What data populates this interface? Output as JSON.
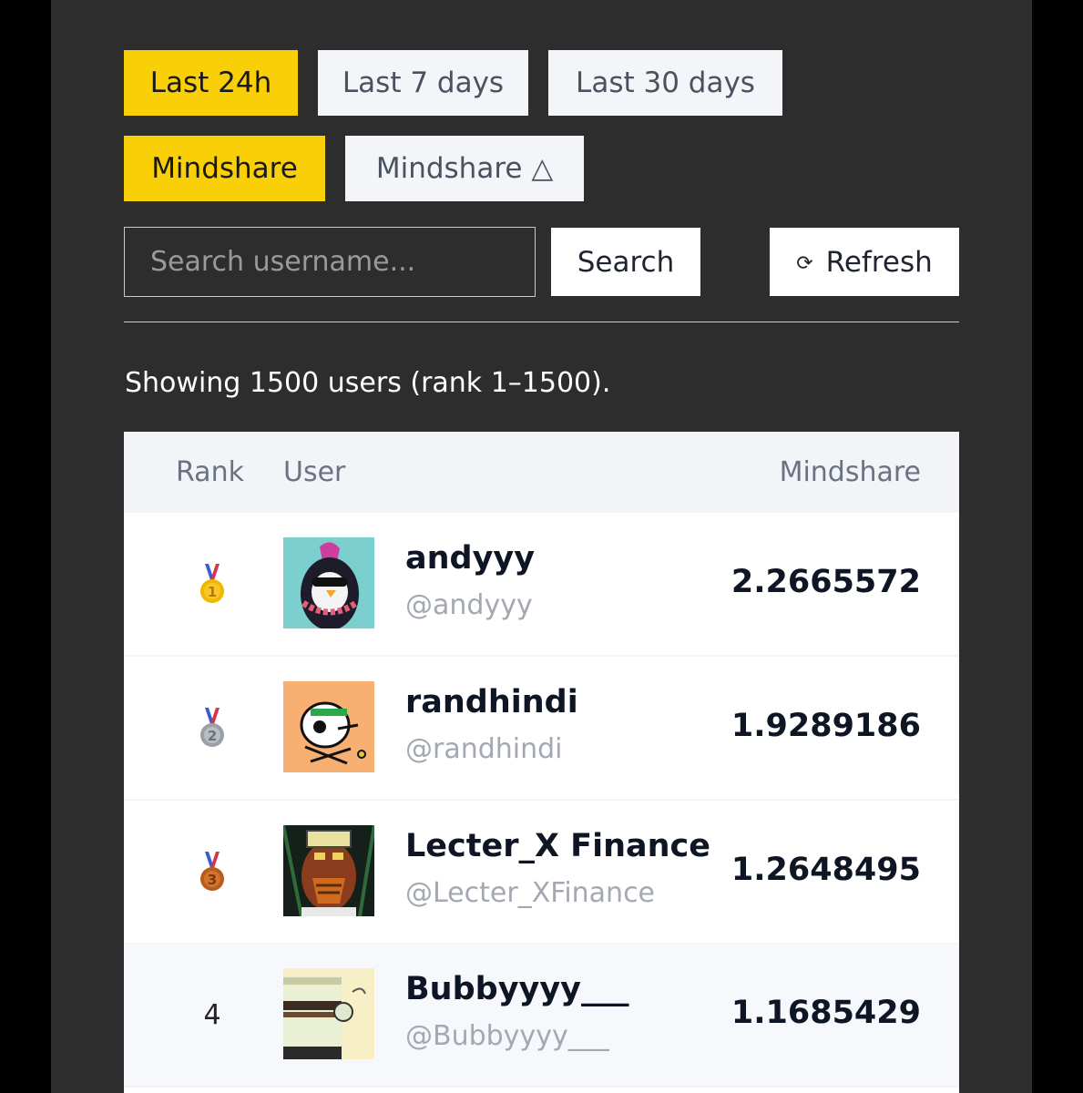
{
  "filters": {
    "time_ranges": [
      {
        "label": "Last 24h",
        "active": true
      },
      {
        "label": "Last 7 days",
        "active": false
      },
      {
        "label": "Last 30 days",
        "active": false
      }
    ],
    "metrics": [
      {
        "label": "Mindshare",
        "active": true
      },
      {
        "label": "Mindshare △",
        "active": false
      }
    ]
  },
  "search": {
    "placeholder": "Search username...",
    "value": "",
    "button_label": "Search"
  },
  "refresh": {
    "icon": "refresh-icon",
    "glyph": "⟳",
    "label": "Refresh"
  },
  "summary": "Showing 1500 users (rank 1–1500).",
  "table": {
    "headers": {
      "rank": "Rank",
      "user": "User",
      "mindshare": "Mindshare"
    },
    "rows": [
      {
        "rank": "1",
        "medal": "gold",
        "name": "andyyy",
        "handle": "@andyyy",
        "mindshare": "2.2665572"
      },
      {
        "rank": "2",
        "medal": "silver",
        "name": "randhindi",
        "handle": "@randhindi",
        "mindshare": "1.9289186"
      },
      {
        "rank": "3",
        "medal": "bronze",
        "name": "Lecter_X Finance",
        "handle": "@Lecter_XFinance",
        "mindshare": "1.2648495"
      },
      {
        "rank": "4",
        "medal": "",
        "name": "Bubbyyyy___",
        "handle": "@Bubbyyyy___",
        "mindshare": "1.1685429"
      }
    ]
  },
  "colors": {
    "accent": "#f9cf08",
    "panel": "#2d2d2d",
    "medal_gold": "#f2b600",
    "medal_silver": "#9aa0a6",
    "medal_bronze": "#b85c1c",
    "ribbon_blue": "#3b5bd6",
    "ribbon_red": "#d9334a"
  }
}
